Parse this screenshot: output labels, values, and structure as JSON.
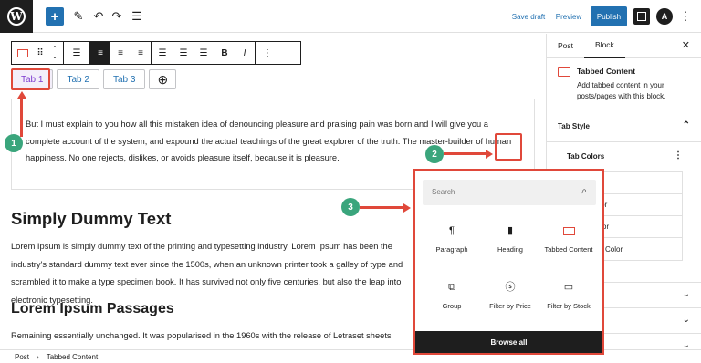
{
  "topbar": {
    "add_icon": "plus-icon",
    "save_draft": "Save draft",
    "preview": "Preview",
    "publish": "Publish",
    "astra_label": "A"
  },
  "tabs": [
    "Tab 1",
    "Tab 2",
    "Tab 3"
  ],
  "tab_content": "But I must explain to you how all this mistaken idea of denouncing pleasure and praising pain was born and I will give you a complete account of the system, and expound the actual teachings of the great explorer of the truth. The master-builder of human happiness. No one rejects, dislikes, or avoids pleasure itself, because it is pleasure.",
  "doc": {
    "heading1": "Simply Dummy Text",
    "para1": "Lorem Ipsum is simply dummy text of the printing and typesetting industry. Lorem Ipsum has been the industry's standard dummy text ever since the 1500s, when an unknown printer took a galley of type and scrambled it to make a type specimen book. It has survived not only five centuries, but also the leap into electronic typesetting.",
    "heading2": "Lorem Ipsum Passages",
    "para2": "Remaining essentially unchanged. It was popularised in the 1960s with the release of Letraset sheets"
  },
  "sidebar": {
    "tab_post": "Post",
    "tab_block": "Block",
    "block_title": "Tabbed Content",
    "block_desc": "Add tabbed content in your posts/pages with this block.",
    "tab_style": "Tab Style",
    "tab_colors": "Tab Colors",
    "color_items": [
      "Color",
      "Tab Color",
      "Title Color",
      "Tab Title Color"
    ]
  },
  "inserter": {
    "search_placeholder": "Search",
    "items": [
      {
        "label": "Paragraph",
        "icon": "paragraph-icon"
      },
      {
        "label": "Heading",
        "icon": "bookmark-icon"
      },
      {
        "label": "Tabbed Content",
        "icon": "tabbed-content-icon"
      },
      {
        "label": "Group",
        "icon": "group-icon"
      },
      {
        "label": "Filter by Price",
        "icon": "price-filter-icon"
      },
      {
        "label": "Filter by Stock",
        "icon": "stock-filter-icon"
      }
    ],
    "browse_all": "Browse all"
  },
  "footer": {
    "crumb1": "Post",
    "sep": "›",
    "crumb2": "Tabbed Content"
  },
  "markers": [
    "1",
    "2",
    "3"
  ],
  "colors": {
    "accent": "#2271b1",
    "highlight": "#e0483a",
    "marker": "#3aa57c"
  }
}
